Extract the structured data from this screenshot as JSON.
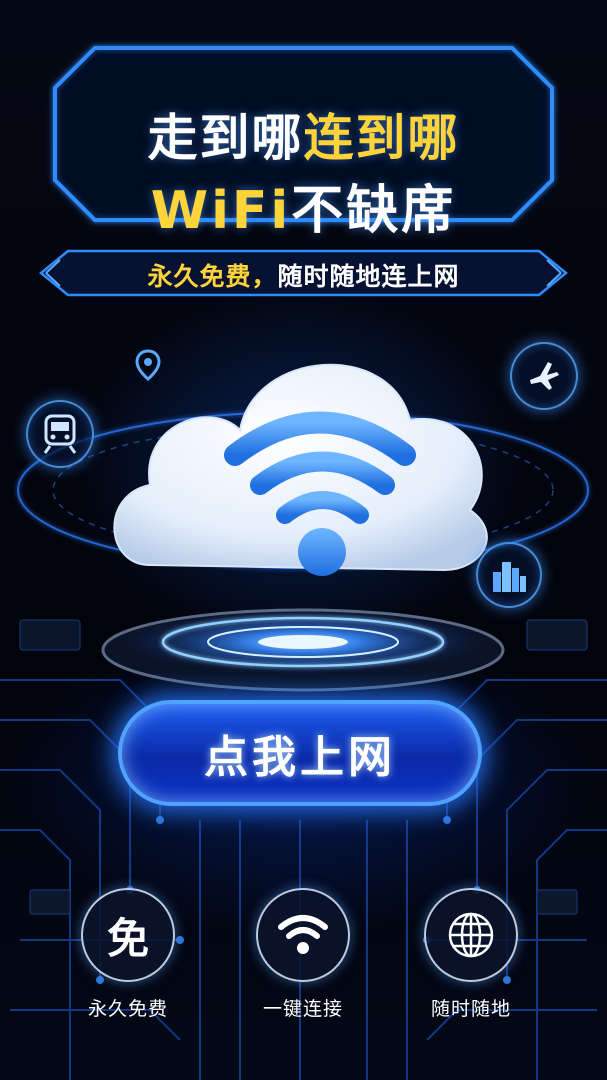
{
  "header": {
    "title_line1_white": "走到哪",
    "title_line1_yellow": "连到哪",
    "title_line2_yellow": "WiFi",
    "title_line2_white": "不缺席"
  },
  "subtitle": {
    "yellow": "永久免费，",
    "white": "随时随地连上网"
  },
  "scene": {
    "icons": [
      "location-pin-icon",
      "train-icon",
      "airplane-icon",
      "city-buildings-icon",
      "cloud-wifi-icon"
    ]
  },
  "cta": {
    "label": "点我上网"
  },
  "features": [
    {
      "icon": "free-badge-icon",
      "char": "免",
      "label": "永久免费"
    },
    {
      "icon": "wifi-icon",
      "char": "",
      "label": "一键连接"
    },
    {
      "icon": "globe-icon",
      "char": "",
      "label": "随时随地"
    }
  ],
  "colors": {
    "accent_yellow": "#ffd43a",
    "neon_blue": "#3a8dff",
    "background": "#02040c"
  }
}
